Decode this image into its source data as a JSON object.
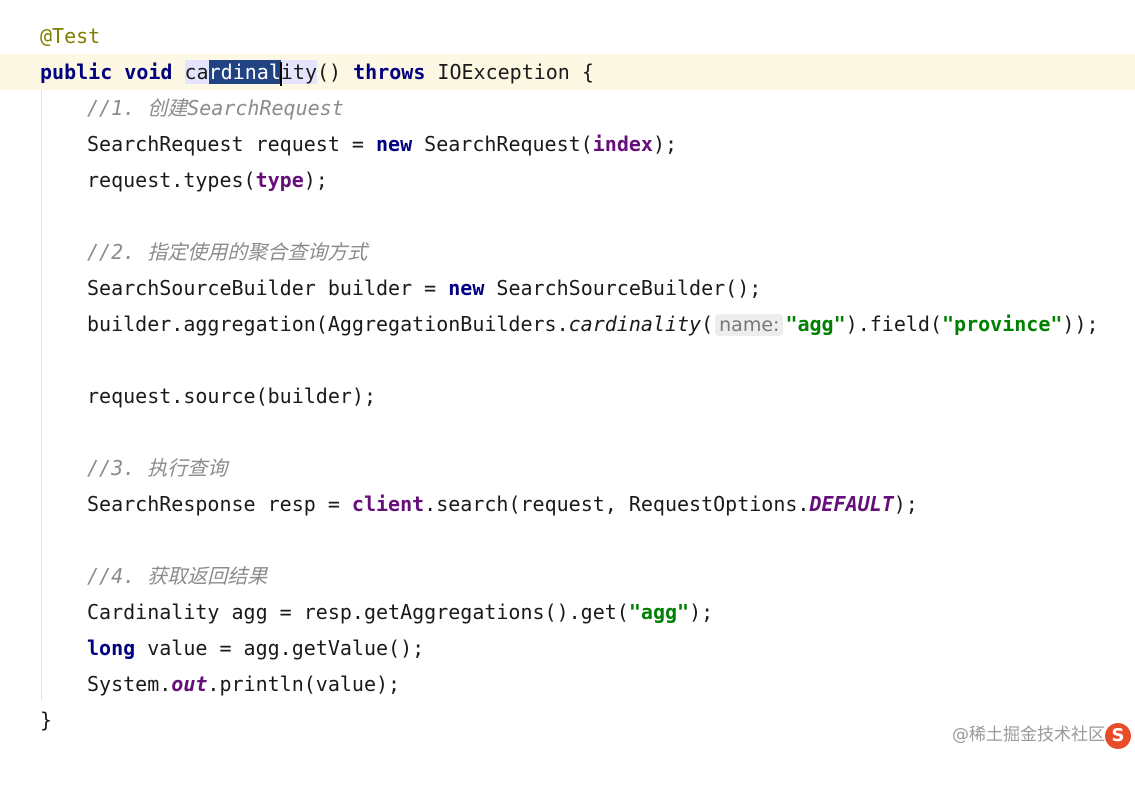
{
  "editor": {
    "annotation": "@Test",
    "method": {
      "kw_public": "public",
      "kw_void": "void",
      "name_pre": "ca",
      "name_sel": "rdinal",
      "name_post": "ity",
      "parens": "() ",
      "kw_throws": "throws",
      "exception": " IOException {"
    },
    "step1_comment": "//1. 创建SearchRequest",
    "line_req": {
      "pre": "SearchRequest request = ",
      "kw_new": "new",
      "cls": " SearchRequest(",
      "arg": "index",
      "post": ");"
    },
    "line_types": {
      "pre": "request.types(",
      "arg": "type",
      "post": ");"
    },
    "step2_comment": "//2. 指定使用的聚合查询方式",
    "line_builder": {
      "pre": "SearchSourceBuilder builder = ",
      "kw_new": "new",
      "post": " SearchSourceBuilder();"
    },
    "line_agg": {
      "pre": "builder.aggregation(AggregationBuilders.",
      "method": "cardinality",
      "open": "(",
      "hint": "name:",
      "str1": "\"agg\"",
      "mid": ").field(",
      "str2": "\"province\"",
      "post": "));"
    },
    "line_source": "request.source(builder);",
    "step3_comment": "//3. 执行查询",
    "line_search": {
      "pre": "SearchResponse resp = ",
      "field": "client",
      "mid": ".search(request, RequestOptions.",
      "const": "DEFAULT",
      "post": ");"
    },
    "step4_comment": "//4. 获取返回结果",
    "line_get": {
      "pre": "Cardinality agg = resp.getAggregations().get(",
      "str": "\"agg\"",
      "post": ");"
    },
    "line_value": {
      "kw_long": "long",
      "post": " value = agg.getValue();"
    },
    "line_print": {
      "pre": "System.",
      "field": "out",
      "post": ".println(value);"
    },
    "closing_brace": "}"
  },
  "watermark": "@稀土掘金技术社区",
  "colors": {
    "keyword": "#000080",
    "annotation": "#808000",
    "string": "#008000",
    "field": "#660e7a",
    "comment": "#8c8c8c",
    "current_line": "#fdf8e4",
    "selection": "#214283"
  }
}
